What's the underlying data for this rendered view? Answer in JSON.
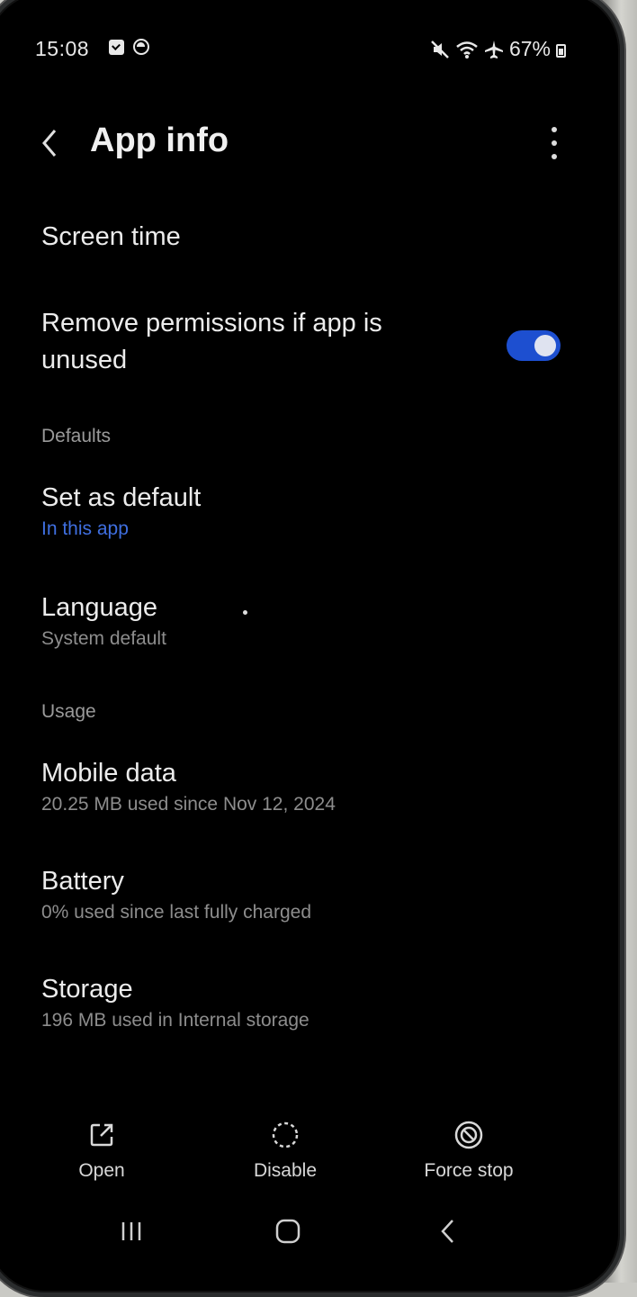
{
  "status_bar": {
    "time": "15:08",
    "battery": "67%"
  },
  "header": {
    "title": "App info"
  },
  "items": {
    "screen_time": {
      "title": "Screen time"
    },
    "remove_permissions": {
      "title_line1": "Remove permissions if app is",
      "title_line2": "unused",
      "toggle_on": true
    },
    "set_as_default": {
      "title": "Set as default",
      "subtitle": "In this app"
    },
    "language": {
      "title": "Language",
      "subtitle": "System default"
    },
    "mobile_data": {
      "title": "Mobile data",
      "subtitle": "20.25 MB used since Nov 12, 2024"
    },
    "battery": {
      "title": "Battery",
      "subtitle": "0% used since last fully charged"
    },
    "storage": {
      "title": "Storage",
      "subtitle": "196 MB used in Internal storage"
    }
  },
  "sections": {
    "defaults": "Defaults",
    "usage": "Usage"
  },
  "actions": {
    "open": "Open",
    "disable": "Disable",
    "force_stop": "Force stop"
  },
  "colors": {
    "accent": "#1d4fd0",
    "link": "#3f6fe0",
    "background": "#000000"
  }
}
